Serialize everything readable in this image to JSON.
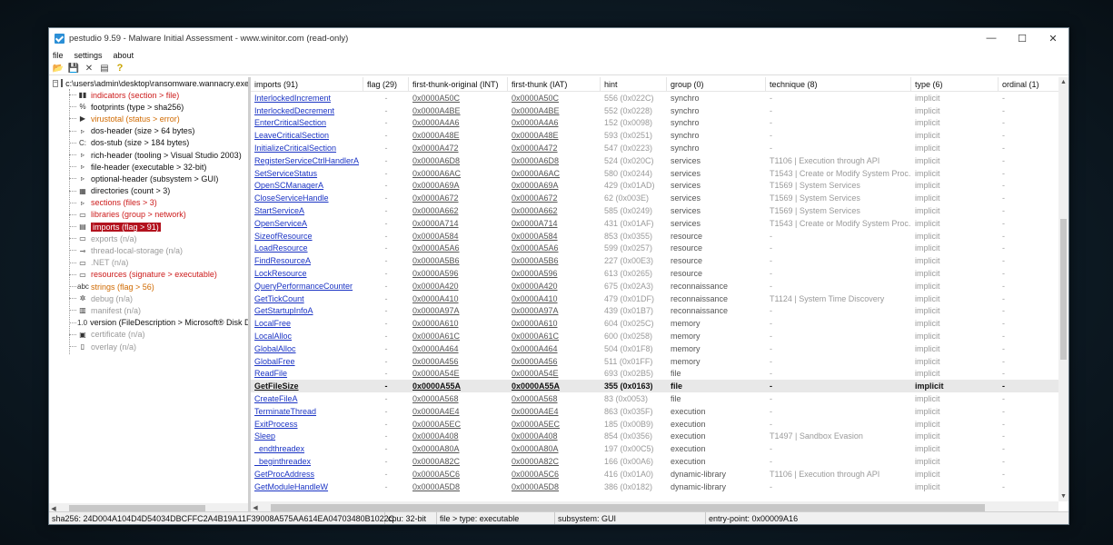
{
  "window": {
    "title": "pestudio 9.59 - Malware Initial Assessment - www.winitor.com (read-only)"
  },
  "menu": [
    "file",
    "settings",
    "about"
  ],
  "toolbar": {
    "open_icon": "📂",
    "save_icon": "💾",
    "close_icon": "✕",
    "list_icon": "▤",
    "help_icon": "?"
  },
  "tree": {
    "root_label": "c:\\users\\admin\\desktop\\ransomware.wannacry.exe",
    "items": [
      {
        "label": "indicators (section > file)",
        "color": "red",
        "icon": "▮▮"
      },
      {
        "label": "footprints (type > sha256)",
        "color": "black",
        "icon": "%"
      },
      {
        "label": "virustotal (status > error)",
        "color": "orange",
        "icon": "▶"
      },
      {
        "label": "dos-header (size > 64 bytes)",
        "color": "black",
        "icon": "▹"
      },
      {
        "label": "dos-stub (size > 184 bytes)",
        "color": "black",
        "icon": "C:"
      },
      {
        "label": "rich-header (tooling > Visual Studio 2003)",
        "color": "black",
        "icon": "▹"
      },
      {
        "label": "file-header (executable > 32-bit)",
        "color": "black",
        "icon": "▹"
      },
      {
        "label": "optional-header (subsystem > GUI)",
        "color": "black",
        "icon": "▹"
      },
      {
        "label": "directories (count > 3)",
        "color": "black",
        "icon": "▦"
      },
      {
        "label": "sections (files > 3)",
        "color": "red",
        "icon": "▹"
      },
      {
        "label": "libraries (group > network)",
        "color": "red",
        "icon": "▭"
      },
      {
        "label": "imports (flag > 91)",
        "color": "selected",
        "icon": "▤"
      },
      {
        "label": "exports (n/a)",
        "color": "gray",
        "icon": "▭"
      },
      {
        "label": "thread-local-storage (n/a)",
        "color": "gray",
        "icon": "⊸"
      },
      {
        "label": ".NET (n/a)",
        "color": "gray",
        "icon": "▭"
      },
      {
        "label": "resources (signature > executable)",
        "color": "red",
        "icon": "▭"
      },
      {
        "label": "strings (flag > 56)",
        "color": "orange",
        "icon": "abc"
      },
      {
        "label": "debug (n/a)",
        "color": "gray",
        "icon": "✲"
      },
      {
        "label": "manifest (n/a)",
        "color": "gray",
        "icon": "▥"
      },
      {
        "label": "version (FileDescription > Microsoft® Disk Defragmenter)",
        "color": "black",
        "icon": "1.0"
      },
      {
        "label": "certificate (n/a)",
        "color": "gray",
        "icon": "▣"
      },
      {
        "label": "overlay (n/a)",
        "color": "gray",
        "icon": "▯"
      }
    ]
  },
  "table": {
    "headers": [
      "imports (91)",
      "flag (29)",
      "first-thunk-original (INT)",
      "first-thunk (IAT)",
      "hint",
      "group (0)",
      "technique (8)",
      "type (6)",
      "ordinal (1)"
    ],
    "rows": [
      [
        "InterlockedIncrement",
        "-",
        "0x0000A50C",
        "0x0000A50C",
        "556 (0x022C)",
        "synchro",
        "-",
        "implicit",
        "-"
      ],
      [
        "InterlockedDecrement",
        "-",
        "0x0000A4BE",
        "0x0000A4BE",
        "552 (0x0228)",
        "synchro",
        "-",
        "implicit",
        "-"
      ],
      [
        "EnterCriticalSection",
        "-",
        "0x0000A4A6",
        "0x0000A4A6",
        "152 (0x0098)",
        "synchro",
        "-",
        "implicit",
        "-"
      ],
      [
        "LeaveCriticalSection",
        "-",
        "0x0000A48E",
        "0x0000A48E",
        "593 (0x0251)",
        "synchro",
        "-",
        "implicit",
        "-"
      ],
      [
        "InitializeCriticalSection",
        "-",
        "0x0000A472",
        "0x0000A472",
        "547 (0x0223)",
        "synchro",
        "-",
        "implicit",
        "-"
      ],
      [
        "RegisterServiceCtrlHandlerA",
        "-",
        "0x0000A6D8",
        "0x0000A6D8",
        "524 (0x020C)",
        "services",
        "T1106 | Execution through API",
        "implicit",
        "-"
      ],
      [
        "SetServiceStatus",
        "-",
        "0x0000A6AC",
        "0x0000A6AC",
        "580 (0x0244)",
        "services",
        "T1543 | Create or Modify System Proc...",
        "implicit",
        "-"
      ],
      [
        "OpenSCManagerA",
        "-",
        "0x0000A69A",
        "0x0000A69A",
        "429 (0x01AD)",
        "services",
        "T1569 | System Services",
        "implicit",
        "-"
      ],
      [
        "CloseServiceHandle",
        "-",
        "0x0000A672",
        "0x0000A672",
        "62 (0x003E)",
        "services",
        "T1569 | System Services",
        "implicit",
        "-"
      ],
      [
        "StartServiceA",
        "-",
        "0x0000A662",
        "0x0000A662",
        "585 (0x0249)",
        "services",
        "T1569 | System Services",
        "implicit",
        "-"
      ],
      [
        "OpenServiceA",
        "-",
        "0x0000A714",
        "0x0000A714",
        "431 (0x01AF)",
        "services",
        "T1543 | Create or Modify System Proc...",
        "implicit",
        "-"
      ],
      [
        "SizeofResource",
        "-",
        "0x0000A584",
        "0x0000A584",
        "853 (0x0355)",
        "resource",
        "-",
        "implicit",
        "-"
      ],
      [
        "LoadResource",
        "-",
        "0x0000A5A6",
        "0x0000A5A6",
        "599 (0x0257)",
        "resource",
        "-",
        "implicit",
        "-"
      ],
      [
        "FindResourceA",
        "-",
        "0x0000A5B6",
        "0x0000A5B6",
        "227 (0x00E3)",
        "resource",
        "-",
        "implicit",
        "-"
      ],
      [
        "LockResource",
        "-",
        "0x0000A596",
        "0x0000A596",
        "613 (0x0265)",
        "resource",
        "-",
        "implicit",
        "-"
      ],
      [
        "QueryPerformanceCounter",
        "-",
        "0x0000A420",
        "0x0000A420",
        "675 (0x02A3)",
        "reconnaissance",
        "-",
        "implicit",
        "-"
      ],
      [
        "GetTickCount",
        "-",
        "0x0000A410",
        "0x0000A410",
        "479 (0x01DF)",
        "reconnaissance",
        "T1124 | System Time Discovery",
        "implicit",
        "-"
      ],
      [
        "GetStartupInfoA",
        "-",
        "0x0000A97A",
        "0x0000A97A",
        "439 (0x01B7)",
        "reconnaissance",
        "-",
        "implicit",
        "-"
      ],
      [
        "LocalFree",
        "-",
        "0x0000A610",
        "0x0000A610",
        "604 (0x025C)",
        "memory",
        "-",
        "implicit",
        "-"
      ],
      [
        "LocalAlloc",
        "-",
        "0x0000A61C",
        "0x0000A61C",
        "600 (0x0258)",
        "memory",
        "-",
        "implicit",
        "-"
      ],
      [
        "GlobalAlloc",
        "-",
        "0x0000A464",
        "0x0000A464",
        "504 (0x01F8)",
        "memory",
        "-",
        "implicit",
        "-"
      ],
      [
        "GlobalFree",
        "-",
        "0x0000A456",
        "0x0000A456",
        "511 (0x01FF)",
        "memory",
        "-",
        "implicit",
        "-"
      ],
      [
        "ReadFile",
        "-",
        "0x0000A54E",
        "0x0000A54E",
        "693 (0x02B5)",
        "file",
        "-",
        "implicit",
        "-"
      ],
      [
        "GetFileSize",
        "-",
        "0x0000A55A",
        "0x0000A55A",
        "355 (0x0163)",
        "file",
        "-",
        "implicit",
        "-"
      ],
      [
        "CreateFileA",
        "-",
        "0x0000A568",
        "0x0000A568",
        "83 (0x0053)",
        "file",
        "-",
        "implicit",
        "-"
      ],
      [
        "TerminateThread",
        "-",
        "0x0000A4E4",
        "0x0000A4E4",
        "863 (0x035F)",
        "execution",
        "-",
        "implicit",
        "-"
      ],
      [
        "ExitProcess",
        "-",
        "0x0000A5EC",
        "0x0000A5EC",
        "185 (0x00B9)",
        "execution",
        "-",
        "implicit",
        "-"
      ],
      [
        "Sleep",
        "-",
        "0x0000A408",
        "0x0000A408",
        "854 (0x0356)",
        "execution",
        "T1497 | Sandbox Evasion",
        "implicit",
        "-"
      ],
      [
        "_endthreadex",
        "-",
        "0x0000A80A",
        "0x0000A80A",
        "197 (0x00C5)",
        "execution",
        "-",
        "implicit",
        "-"
      ],
      [
        "_beginthreadex",
        "-",
        "0x0000A82C",
        "0x0000A82C",
        "166 (0x00A6)",
        "execution",
        "-",
        "implicit",
        "-"
      ],
      [
        "GetProcAddress",
        "-",
        "0x0000A5C6",
        "0x0000A5C6",
        "416 (0x01A0)",
        "dynamic-library",
        "T1106 | Execution through API",
        "implicit",
        "-"
      ],
      [
        "GetModuleHandleW",
        "-",
        "0x0000A5D8",
        "0x0000A5D8",
        "386 (0x0182)",
        "dynamic-library",
        "-",
        "implicit",
        "-"
      ]
    ],
    "selected_row": 23
  },
  "status": {
    "sha256": "sha256: 24D004A104D4D54034DBCFFC2A4B19A11F39008A575AA614EA04703480B1022C",
    "cpu": "cpu: 32-bit",
    "file_type": "file > type: executable",
    "subsystem": "subsystem: GUI",
    "entry_point": "entry-point: 0x00009A16"
  }
}
